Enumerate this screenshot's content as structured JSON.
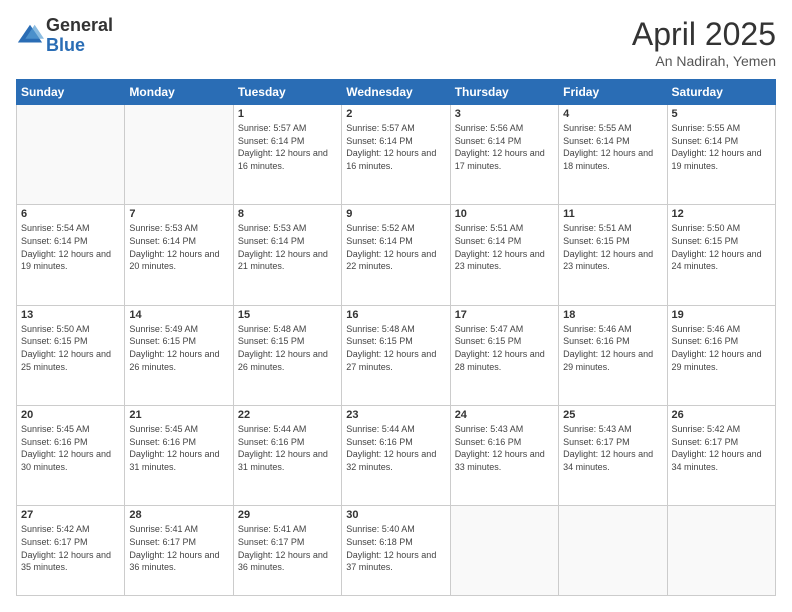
{
  "header": {
    "logo_general": "General",
    "logo_blue": "Blue",
    "title": "April 2025",
    "subtitle": "An Nadirah, Yemen"
  },
  "weekdays": [
    "Sunday",
    "Monday",
    "Tuesday",
    "Wednesday",
    "Thursday",
    "Friday",
    "Saturday"
  ],
  "weeks": [
    [
      {
        "day": "",
        "info": ""
      },
      {
        "day": "",
        "info": ""
      },
      {
        "day": "1",
        "info": "Sunrise: 5:57 AM\nSunset: 6:14 PM\nDaylight: 12 hours and 16 minutes."
      },
      {
        "day": "2",
        "info": "Sunrise: 5:57 AM\nSunset: 6:14 PM\nDaylight: 12 hours and 16 minutes."
      },
      {
        "day": "3",
        "info": "Sunrise: 5:56 AM\nSunset: 6:14 PM\nDaylight: 12 hours and 17 minutes."
      },
      {
        "day": "4",
        "info": "Sunrise: 5:55 AM\nSunset: 6:14 PM\nDaylight: 12 hours and 18 minutes."
      },
      {
        "day": "5",
        "info": "Sunrise: 5:55 AM\nSunset: 6:14 PM\nDaylight: 12 hours and 19 minutes."
      }
    ],
    [
      {
        "day": "6",
        "info": "Sunrise: 5:54 AM\nSunset: 6:14 PM\nDaylight: 12 hours and 19 minutes."
      },
      {
        "day": "7",
        "info": "Sunrise: 5:53 AM\nSunset: 6:14 PM\nDaylight: 12 hours and 20 minutes."
      },
      {
        "day": "8",
        "info": "Sunrise: 5:53 AM\nSunset: 6:14 PM\nDaylight: 12 hours and 21 minutes."
      },
      {
        "day": "9",
        "info": "Sunrise: 5:52 AM\nSunset: 6:14 PM\nDaylight: 12 hours and 22 minutes."
      },
      {
        "day": "10",
        "info": "Sunrise: 5:51 AM\nSunset: 6:14 PM\nDaylight: 12 hours and 23 minutes."
      },
      {
        "day": "11",
        "info": "Sunrise: 5:51 AM\nSunset: 6:15 PM\nDaylight: 12 hours and 23 minutes."
      },
      {
        "day": "12",
        "info": "Sunrise: 5:50 AM\nSunset: 6:15 PM\nDaylight: 12 hours and 24 minutes."
      }
    ],
    [
      {
        "day": "13",
        "info": "Sunrise: 5:50 AM\nSunset: 6:15 PM\nDaylight: 12 hours and 25 minutes."
      },
      {
        "day": "14",
        "info": "Sunrise: 5:49 AM\nSunset: 6:15 PM\nDaylight: 12 hours and 26 minutes."
      },
      {
        "day": "15",
        "info": "Sunrise: 5:48 AM\nSunset: 6:15 PM\nDaylight: 12 hours and 26 minutes."
      },
      {
        "day": "16",
        "info": "Sunrise: 5:48 AM\nSunset: 6:15 PM\nDaylight: 12 hours and 27 minutes."
      },
      {
        "day": "17",
        "info": "Sunrise: 5:47 AM\nSunset: 6:15 PM\nDaylight: 12 hours and 28 minutes."
      },
      {
        "day": "18",
        "info": "Sunrise: 5:46 AM\nSunset: 6:16 PM\nDaylight: 12 hours and 29 minutes."
      },
      {
        "day": "19",
        "info": "Sunrise: 5:46 AM\nSunset: 6:16 PM\nDaylight: 12 hours and 29 minutes."
      }
    ],
    [
      {
        "day": "20",
        "info": "Sunrise: 5:45 AM\nSunset: 6:16 PM\nDaylight: 12 hours and 30 minutes."
      },
      {
        "day": "21",
        "info": "Sunrise: 5:45 AM\nSunset: 6:16 PM\nDaylight: 12 hours and 31 minutes."
      },
      {
        "day": "22",
        "info": "Sunrise: 5:44 AM\nSunset: 6:16 PM\nDaylight: 12 hours and 31 minutes."
      },
      {
        "day": "23",
        "info": "Sunrise: 5:44 AM\nSunset: 6:16 PM\nDaylight: 12 hours and 32 minutes."
      },
      {
        "day": "24",
        "info": "Sunrise: 5:43 AM\nSunset: 6:16 PM\nDaylight: 12 hours and 33 minutes."
      },
      {
        "day": "25",
        "info": "Sunrise: 5:43 AM\nSunset: 6:17 PM\nDaylight: 12 hours and 34 minutes."
      },
      {
        "day": "26",
        "info": "Sunrise: 5:42 AM\nSunset: 6:17 PM\nDaylight: 12 hours and 34 minutes."
      }
    ],
    [
      {
        "day": "27",
        "info": "Sunrise: 5:42 AM\nSunset: 6:17 PM\nDaylight: 12 hours and 35 minutes."
      },
      {
        "day": "28",
        "info": "Sunrise: 5:41 AM\nSunset: 6:17 PM\nDaylight: 12 hours and 36 minutes."
      },
      {
        "day": "29",
        "info": "Sunrise: 5:41 AM\nSunset: 6:17 PM\nDaylight: 12 hours and 36 minutes."
      },
      {
        "day": "30",
        "info": "Sunrise: 5:40 AM\nSunset: 6:18 PM\nDaylight: 12 hours and 37 minutes."
      },
      {
        "day": "",
        "info": ""
      },
      {
        "day": "",
        "info": ""
      },
      {
        "day": "",
        "info": ""
      }
    ]
  ]
}
